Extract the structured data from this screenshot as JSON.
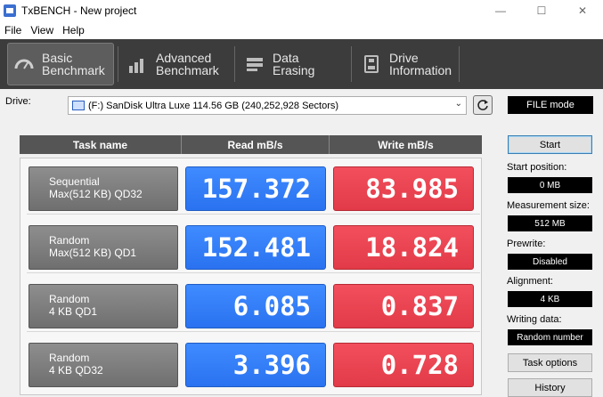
{
  "window": {
    "title": "TxBENCH - New project",
    "minimize_glyph": "—",
    "maximize_glyph": "☐",
    "close_glyph": "✕"
  },
  "menu": [
    "File",
    "View",
    "Help"
  ],
  "tabs": [
    {
      "line1": "Basic",
      "line2": "Benchmark",
      "icon": "gauge-icon",
      "active": true
    },
    {
      "line1": "Advanced",
      "line2": "Benchmark",
      "icon": "bar-chart-icon",
      "active": false
    },
    {
      "line1": "Data Erasing",
      "line2": "",
      "icon": "eraser-icon",
      "active": false
    },
    {
      "line1": "Drive",
      "line2": "Information",
      "icon": "drive-info-icon",
      "active": false
    }
  ],
  "drive": {
    "label": "Drive:",
    "selected": "(F:) SanDisk Ultra Luxe  114.56 GB (240,252,928 Sectors)"
  },
  "table": {
    "headers": [
      "Task name",
      "Read mB/s",
      "Write mB/s"
    ],
    "rows": [
      {
        "task_line1": "Sequential",
        "task_line2": "Max(512 KB) QD32",
        "read": "157.372",
        "write": "83.985"
      },
      {
        "task_line1": "Random",
        "task_line2": "Max(512 KB) QD1",
        "read": "152.481",
        "write": "18.824"
      },
      {
        "task_line1": "Random",
        "task_line2": "4 KB QD1",
        "read": "6.085",
        "write": "0.837"
      },
      {
        "task_line1": "Random",
        "task_line2": "4 KB QD32",
        "read": "3.396",
        "write": "0.728"
      }
    ]
  },
  "side": {
    "mode": "FILE mode",
    "start": "Start",
    "start_position_label": "Start position:",
    "start_position_value": "0 MB",
    "measurement_size_label": "Measurement size:",
    "measurement_size_value": "512 MB",
    "prewrite_label": "Prewrite:",
    "prewrite_value": "Disabled",
    "alignment_label": "Alignment:",
    "alignment_value": "4 KB",
    "writing_data_label": "Writing data:",
    "writing_data_value": "Random number",
    "task_options": "Task options",
    "history": "History"
  },
  "colors": {
    "read": "#2f7bf5",
    "write": "#ea4452",
    "toolbar": "#3c3c3c"
  }
}
